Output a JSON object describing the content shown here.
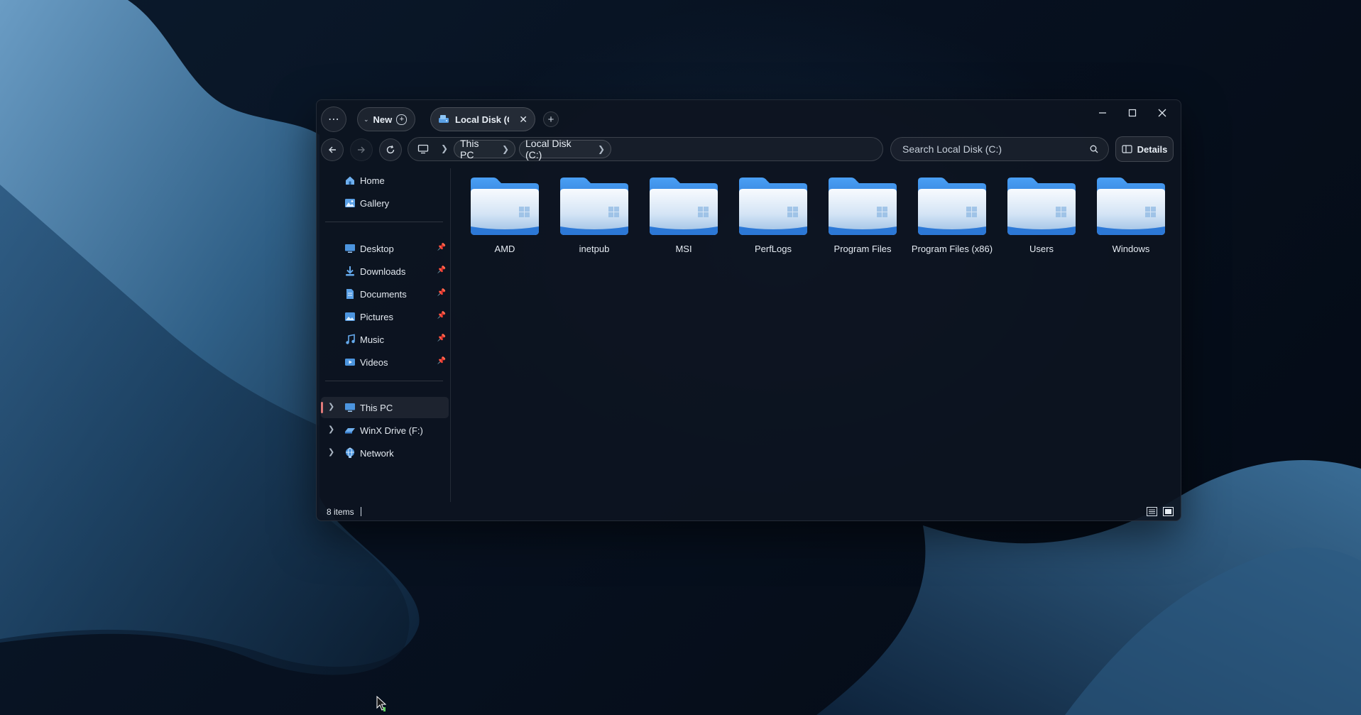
{
  "explorer": {
    "toolbar": {
      "more_icon": "ellipsis-icon",
      "new_label": "New"
    },
    "tab": {
      "title": "Local Disk (C:",
      "icon": "drive-icon"
    },
    "address": {
      "root_icon": "monitor-icon",
      "crumbs": [
        "This PC",
        "Local Disk (C:)"
      ]
    },
    "search": {
      "placeholder": "Search Local Disk (C:)"
    },
    "details_label": "Details",
    "sidebar": {
      "quick": [
        {
          "label": "Home",
          "icon": "home-icon"
        },
        {
          "label": "Gallery",
          "icon": "gallery-icon"
        }
      ],
      "pinned": [
        {
          "label": "Desktop",
          "icon": "desktop-icon"
        },
        {
          "label": "Downloads",
          "icon": "download-icon"
        },
        {
          "label": "Documents",
          "icon": "documents-icon"
        },
        {
          "label": "Pictures",
          "icon": "pictures-icon"
        },
        {
          "label": "Music",
          "icon": "music-icon"
        },
        {
          "label": "Videos",
          "icon": "videos-icon"
        }
      ],
      "locations": [
        {
          "label": "This PC",
          "icon": "this-pc-icon",
          "selected": true
        },
        {
          "label": "WinX Drive (F:)",
          "icon": "drive-icon"
        },
        {
          "label": "Network",
          "icon": "network-icon"
        }
      ]
    },
    "folders": [
      "AMD",
      "inetpub",
      "MSI",
      "PerfLogs",
      "Program Files",
      "Program Files (x86)",
      "Users",
      "Windows"
    ],
    "status": {
      "item_count": "8 items"
    },
    "colors": {
      "accent": "#e07a7a",
      "folder_blue": "#2f7fe0"
    }
  }
}
